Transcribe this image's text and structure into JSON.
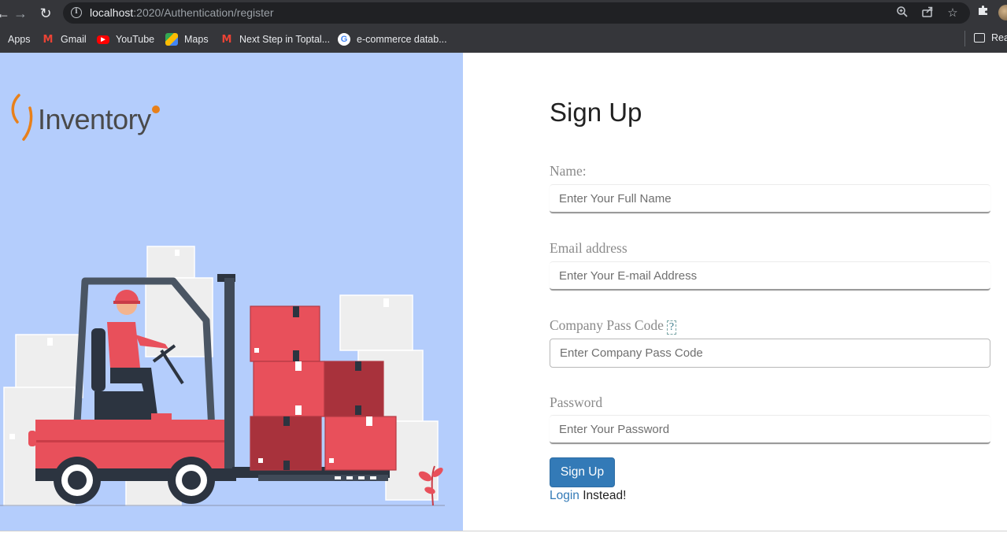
{
  "browser": {
    "url_host": "localhost",
    "url_rest": ":2020/Authentication/register",
    "bookmarks": [
      {
        "label": "Apps",
        "icon": "apps-grid-icon"
      },
      {
        "label": "Gmail",
        "icon": "gmail-icon"
      },
      {
        "label": "YouTube",
        "icon": "youtube-icon"
      },
      {
        "label": "Maps",
        "icon": "maps-icon"
      },
      {
        "label": "Next Step in Toptal...",
        "icon": "gmail-icon"
      },
      {
        "label": "e-commerce datab...",
        "icon": "google-icon"
      }
    ],
    "reading_list": "Rea"
  },
  "brand": {
    "logo_text": "Inventory",
    "hero_color": "#b4cdfc"
  },
  "form": {
    "title": "Sign Up",
    "name_label": "Name:",
    "name_placeholder": "Enter Your Full Name",
    "email_label": "Email address",
    "email_placeholder": "Enter Your E-mail Address",
    "passcode_label": "Company Pass Code",
    "passcode_help": "?",
    "passcode_placeholder": "Enter Company Pass Code",
    "password_label": "Password",
    "password_placeholder": "Enter Your Password",
    "submit_label": "Sign Up",
    "login_link": "Login",
    "login_suffix": " Instead!"
  },
  "colors": {
    "primary": "#337ab7",
    "logo_orange": "#e8801a"
  }
}
